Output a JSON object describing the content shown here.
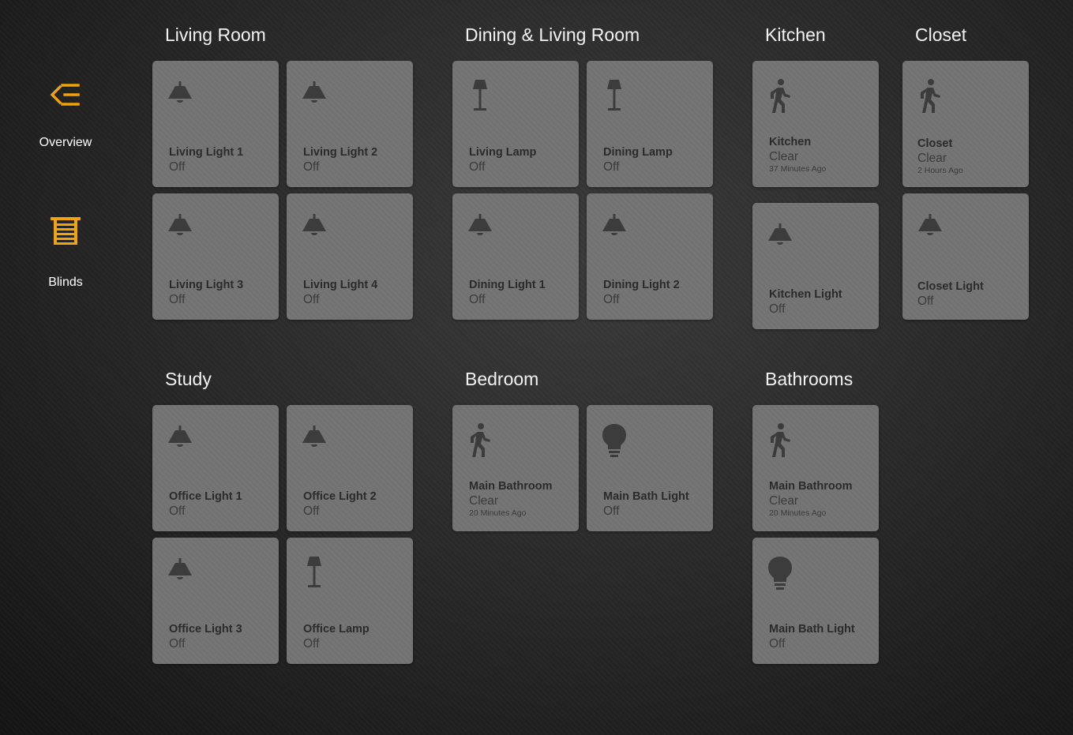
{
  "colors": {
    "accent": "#f0a30a",
    "tile_bg": "#727272",
    "icon": "#3c3c3c"
  },
  "sidebar": [
    {
      "label": "Overview",
      "icon": "menu-collapse-icon"
    },
    {
      "label": "Blinds",
      "icon": "blinds-icon"
    }
  ],
  "sections": [
    {
      "title": "Living Room",
      "tiles": [
        {
          "name": "Living Light 1",
          "state": "Off",
          "icon": "ceiling-light-icon"
        },
        {
          "name": "Living Light 2",
          "state": "Off",
          "icon": "ceiling-light-icon"
        },
        {
          "name": "Living Light 3",
          "state": "Off",
          "icon": "ceiling-light-icon"
        },
        {
          "name": "Living Light 4",
          "state": "Off",
          "icon": "ceiling-light-icon"
        }
      ]
    },
    {
      "title": "Dining & Living Room",
      "tiles": [
        {
          "name": "Living Lamp",
          "state": "Off",
          "icon": "floor-lamp-icon"
        },
        {
          "name": "Dining Lamp",
          "state": "Off",
          "icon": "floor-lamp-icon"
        },
        {
          "name": "Dining Light 1",
          "state": "Off",
          "icon": "ceiling-light-icon"
        },
        {
          "name": "Dining Light 2",
          "state": "Off",
          "icon": "ceiling-light-icon"
        }
      ]
    },
    {
      "title": "Kitchen",
      "tiles": [
        {
          "name": "Kitchen",
          "state": "Clear",
          "sub": "37 Minutes Ago",
          "icon": "motion-sensor-icon"
        },
        {
          "name": "Kitchen Light",
          "state": "Off",
          "icon": "ceiling-light-icon"
        }
      ]
    },
    {
      "title": "Closet",
      "tiles": [
        {
          "name": "Closet",
          "state": "Clear",
          "sub": "2 Hours Ago",
          "icon": "motion-sensor-icon"
        },
        {
          "name": "Closet Light",
          "state": "Off",
          "icon": "ceiling-light-icon"
        }
      ]
    },
    {
      "title": "Study",
      "tiles": [
        {
          "name": "Office Light 1",
          "state": "Off",
          "icon": "ceiling-light-icon"
        },
        {
          "name": "Office Light 2",
          "state": "Off",
          "icon": "ceiling-light-icon"
        },
        {
          "name": "Office Light 3",
          "state": "Off",
          "icon": "ceiling-light-icon"
        },
        {
          "name": "Office Lamp",
          "state": "Off",
          "icon": "floor-lamp-icon"
        }
      ]
    },
    {
      "title": "Bedroom",
      "tiles": [
        {
          "name": "Main Bathroom",
          "state": "Clear",
          "sub": "20 Minutes Ago",
          "icon": "motion-sensor-icon"
        },
        {
          "name": "Main Bath Light",
          "state": "Off",
          "icon": "lightbulb-icon"
        }
      ]
    },
    {
      "title": "Bathrooms",
      "tiles": [
        {
          "name": "Main Bathroom",
          "state": "Clear",
          "sub": "20 Minutes Ago",
          "icon": "motion-sensor-icon"
        },
        {
          "name": "Main Bath Light",
          "state": "Off",
          "icon": "lightbulb-icon"
        }
      ]
    }
  ]
}
